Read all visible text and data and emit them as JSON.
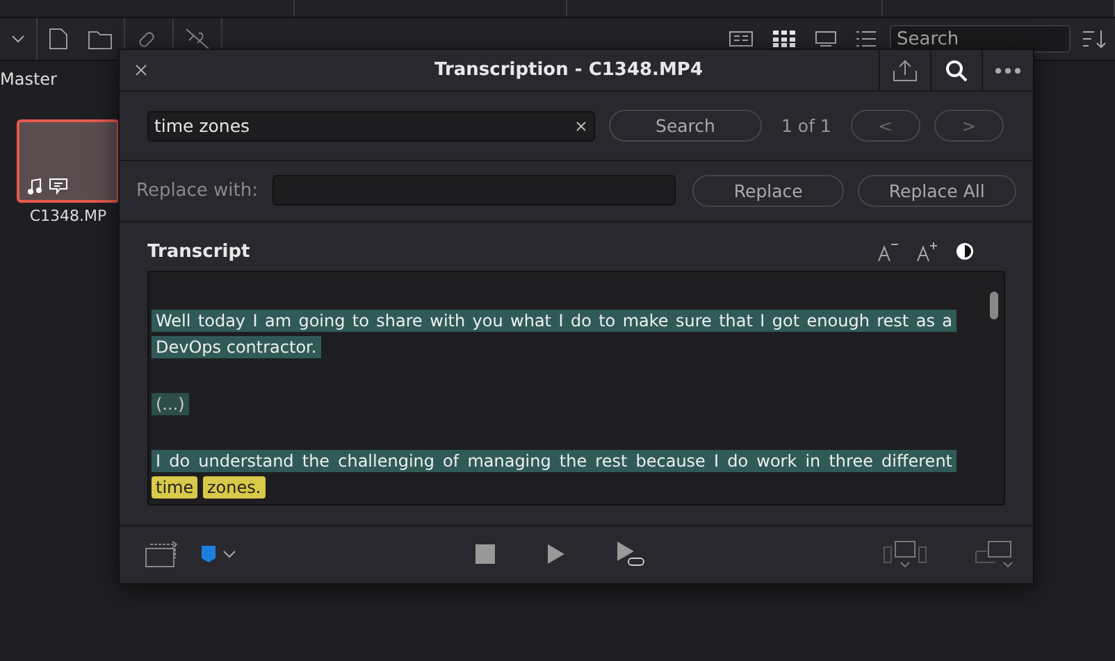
{
  "media_pool": {
    "bin": "Master",
    "search": {
      "placeholder": "Search"
    },
    "clips": [
      {
        "name": "C1348.MP",
        "selected": true
      }
    ]
  },
  "dialog": {
    "title": "Transcription - C1348.MP4",
    "find": {
      "value": "time zones",
      "search_button": "Search",
      "count": "1 of 1",
      "prev": "<",
      "next": ">"
    },
    "replace": {
      "label": "Replace with:",
      "replace_button": "Replace",
      "replace_all_button": "Replace All"
    },
    "transcript": {
      "heading": "Transcript",
      "paragraphs": [
        {
          "kind": "speech",
          "segments": [
            {
              "text": "Well today I am going to share with you what I do to make sure that I got enough rest as a DevOps contractor.",
              "match": false
            }
          ]
        },
        {
          "kind": "silence",
          "segments": [
            {
              "text": "(...)",
              "match": false
            }
          ]
        },
        {
          "kind": "speech",
          "segments": [
            {
              "text": "I do understand the challenging of managing the rest because I do work in three different",
              "match": false
            },
            {
              "text": "time",
              "match": true
            },
            {
              "text": "zones.",
              "match": true
            }
          ]
        }
      ]
    }
  }
}
